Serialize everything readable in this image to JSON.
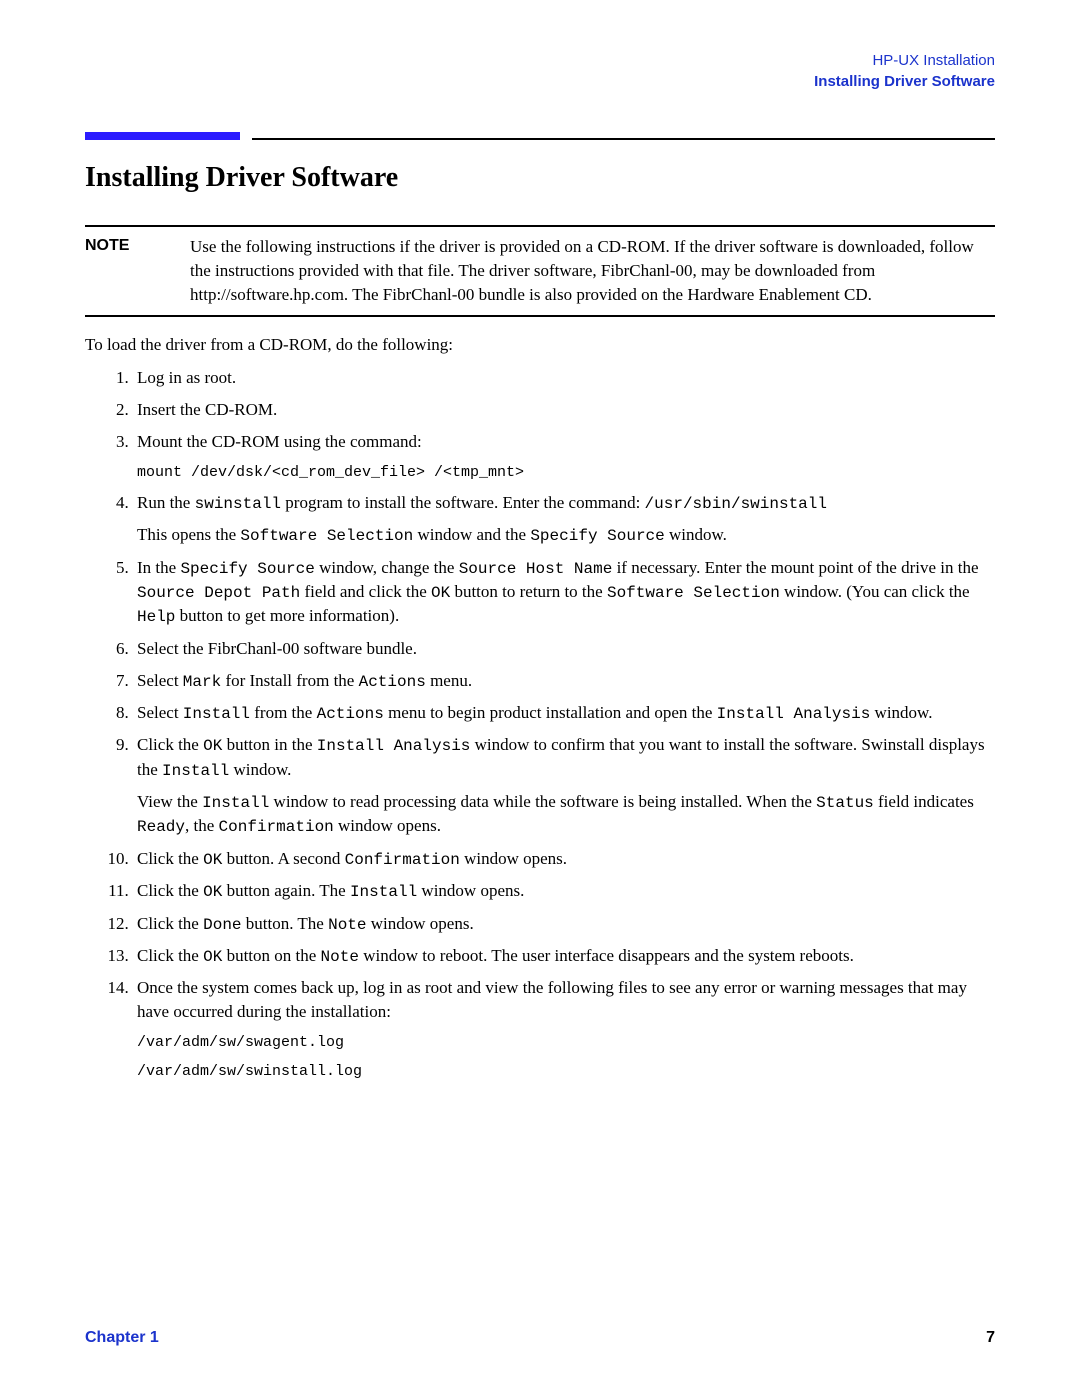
{
  "header": {
    "chapter_name": "HP-UX Installation",
    "section_name": "Installing Driver Software"
  },
  "title": "Installing Driver Software",
  "note": {
    "label": "NOTE",
    "text": "Use the following instructions if the driver is provided on a CD-ROM. If the driver software is downloaded, follow the instructions provided with that file. The driver software, FibrChanl-00, may be downloaded from http://software.hp.com. The FibrChanl-00 bundle is also provided on the Hardware Enablement CD."
  },
  "intro": "To load the driver from a CD-ROM, do the following:",
  "steps": {
    "s1": "Log in as root.",
    "s2": "Insert the CD-ROM.",
    "s3": {
      "text": "Mount the CD-ROM using the command:",
      "code": "mount /dev/dsk/<cd_rom_dev_file> /<tmp_mnt>"
    },
    "s4": {
      "pre": "Run the ",
      "c1": "swinstall",
      "mid": " program to install the software. Enter the command: ",
      "c2": "/usr/sbin/swinstall",
      "sub_pre": "This opens the ",
      "sub_c1": "Software Selection",
      "sub_mid": " window and the ",
      "sub_c2": "Specify Source",
      "sub_post": " window."
    },
    "s5": {
      "p1": "In the ",
      "c1": "Specify Source",
      "p2": " window, change the ",
      "c2": "Source Host Name",
      "p3": " if necessary. Enter the mount point of the drive in the ",
      "c3": "Source Depot Path",
      "p4": " field and click the ",
      "c4": "OK",
      "p5": " button to return to the ",
      "c5": "Software Selection",
      "p6": " window. (You can click the ",
      "c6": "Help",
      "p7": " button to get more information)."
    },
    "s6": "Select the FibrChanl-00 software bundle.",
    "s7": {
      "p1": "Select ",
      "c1": "Mark",
      "p2": " for Install from the ",
      "c2": "Actions",
      "p3": " menu."
    },
    "s8": {
      "p1": "Select ",
      "c1": "Install",
      "p2": " from the ",
      "c2": "Actions",
      "p3": " menu to begin product installation and open the ",
      "c3": "Install Analysis",
      "p4": " window."
    },
    "s9": {
      "p1": "Click the ",
      "c1": "OK",
      "p2": " button in the ",
      "c2": "Install Analysis",
      "p3": " window to confirm that you want to install the software. Swinstall displays the ",
      "c3": "Install",
      "p4": " window.",
      "sub_p1": "View the ",
      "sub_c1": "Install",
      "sub_p2": " window to read processing data while the software is being installed. When the ",
      "sub_c2": "Status",
      "sub_p3": " field indicates ",
      "sub_c3": "Ready",
      "sub_p4": ", the ",
      "sub_c4": "Confirmation",
      "sub_p5": " window opens."
    },
    "s10": {
      "p1": "Click the ",
      "c1": "OK",
      "p2": " button. A second ",
      "c2": "Confirmation",
      "p3": " window opens."
    },
    "s11": {
      "p1": "Click the ",
      "c1": "OK",
      "p2": " button again. The ",
      "c2": "Install",
      "p3": " window opens."
    },
    "s12": {
      "p1": "Click the ",
      "c1": "Done",
      "p2": " button. The ",
      "c2": "Note",
      "p3": " window opens."
    },
    "s13": {
      "p1": "Click the ",
      "c1": "OK",
      "p2": " button on the ",
      "c2": "Note",
      "p3": " window to reboot. The user interface disappears and the system reboots."
    },
    "s14": {
      "text": "Once the system comes back up, log in as root and view the following files to see any error or warning messages that may have occurred during the installation:",
      "code1": "/var/adm/sw/swagent.log",
      "code2": "/var/adm/sw/swinstall.log"
    }
  },
  "footer": {
    "chapter_label": "Chapter 1",
    "page_number": "7"
  }
}
